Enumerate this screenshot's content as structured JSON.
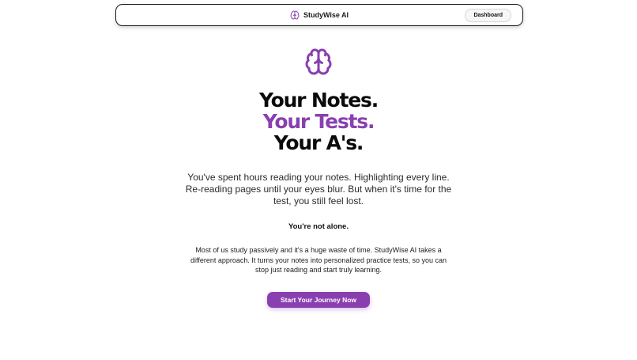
{
  "brand": {
    "name": "StudyWise AI",
    "icon": "brain-icon"
  },
  "nav": {
    "dashboard_label": "Dashboard"
  },
  "hero": {
    "icon": "brain-icon",
    "headline": [
      "Your Notes.",
      "Your Tests.",
      "Your A's."
    ],
    "intro": "You've spent hours reading your notes. Highlighting every line. Re-reading pages until your eyes blur. But when it's time for the test, you still feel lost.",
    "not_alone": "You're not alone.",
    "body": "Most of us study passively and it's a huge waste of time. StudyWise AI takes a different approach. It turns your notes into personalized practice tests, so you can stop just reading and start truly learning.",
    "cta_label": "Start Your Journey Now"
  },
  "colors": {
    "accent": "#8a3fb0",
    "text": "#111111",
    "background": "#ffffff"
  }
}
